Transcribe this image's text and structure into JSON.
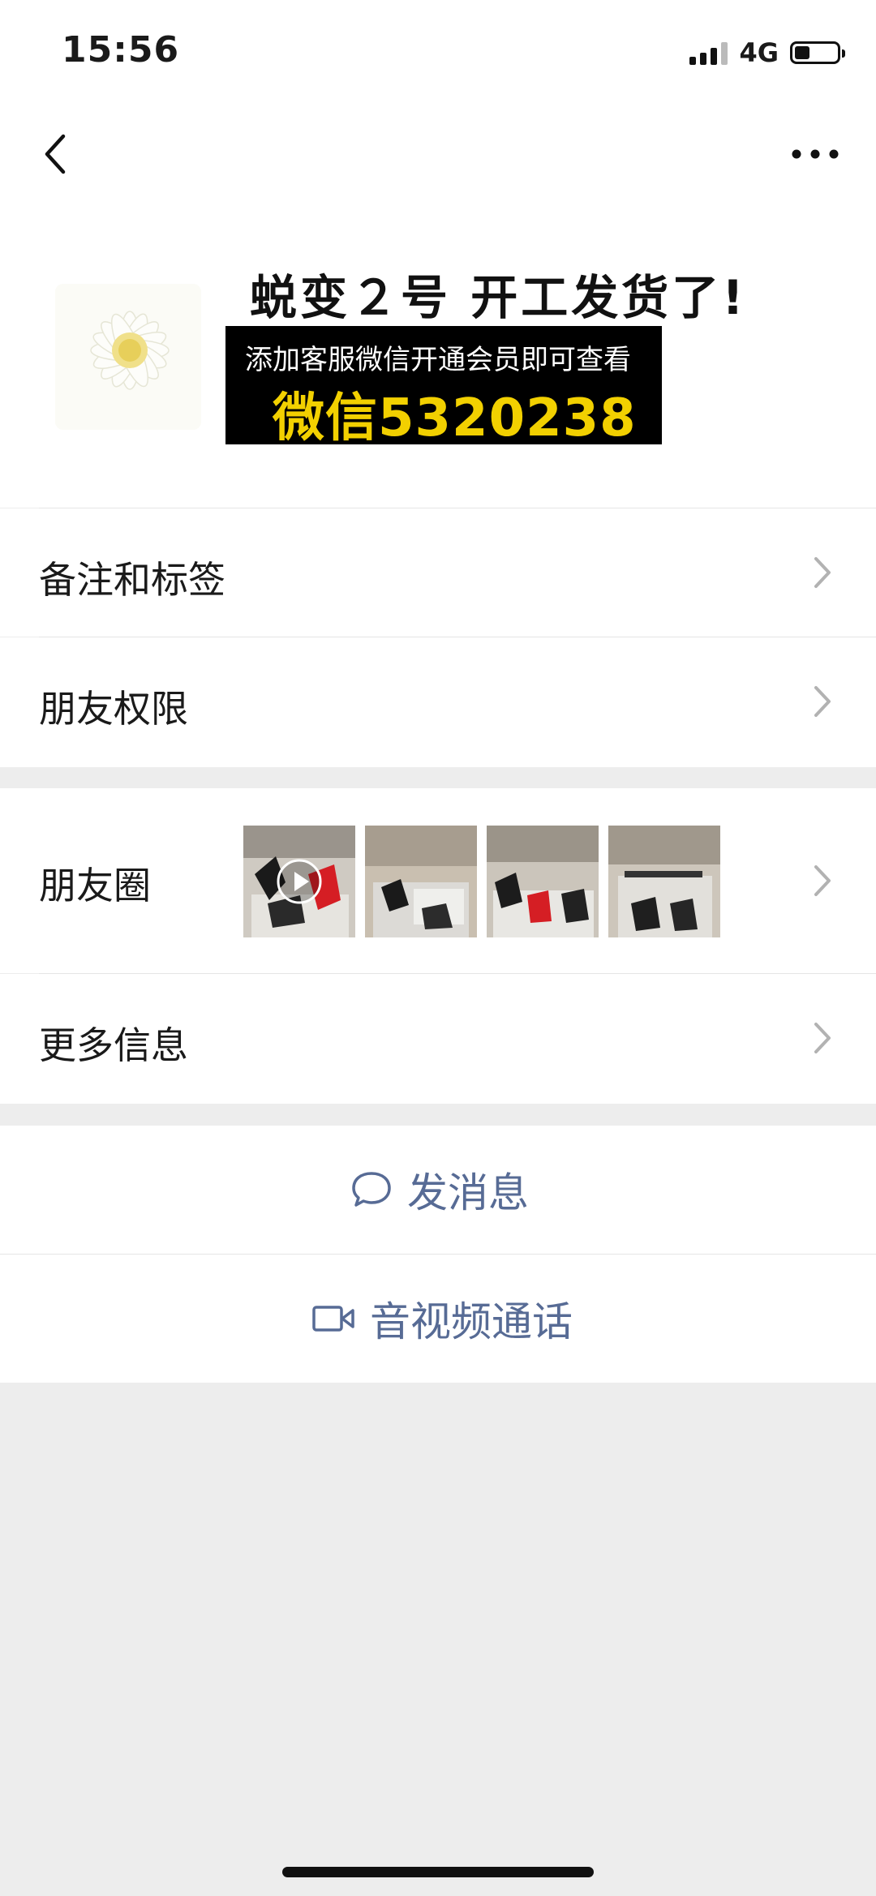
{
  "status_bar": {
    "time": "15:56",
    "network": "4G"
  },
  "profile": {
    "nickname": "蜕变２号  开工发货了!",
    "promo_line1": "添加客服微信开通会员即可查看",
    "promo_line2": "微信5320238"
  },
  "rows": {
    "remarks": "备注和标签",
    "permissions": "朋友权限",
    "moments": "朋友圈",
    "more_info": "更多信息"
  },
  "actions": {
    "message": "发消息",
    "call": "音视频通话"
  },
  "icons": {
    "back": "back-icon",
    "more": "more-icon",
    "chevron": "chevron-right-icon",
    "message": "chat-bubble-icon",
    "call": "video-camera-icon",
    "play": "play-icon"
  },
  "colors": {
    "link": "#576b95",
    "background": "#ededed",
    "promo_highlight": "#f2d000"
  }
}
